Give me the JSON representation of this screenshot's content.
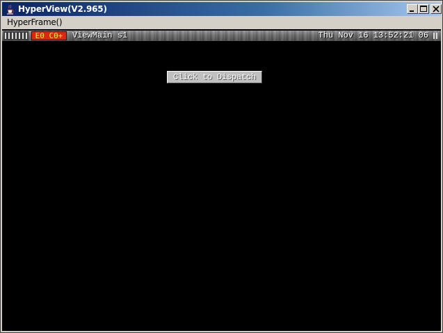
{
  "window": {
    "title": "HyperView(V2.965)",
    "icon": "java-cup-icon"
  },
  "menubar": {
    "items": [
      {
        "label": "HyperFrame()"
      }
    ]
  },
  "statusbar": {
    "badge": "E0 C0+",
    "view_name": "ViewMain s1",
    "clock": "Thu Nov 16 13:52:21 06"
  },
  "main": {
    "dispatch_button": "Click to Dispatch"
  },
  "colors": {
    "title_gradient_start": "#0a246a",
    "title_gradient_end": "#a6caf0",
    "content_background": "#000000",
    "badge_background": "#d82a10",
    "badge_text": "#ffe84a"
  }
}
